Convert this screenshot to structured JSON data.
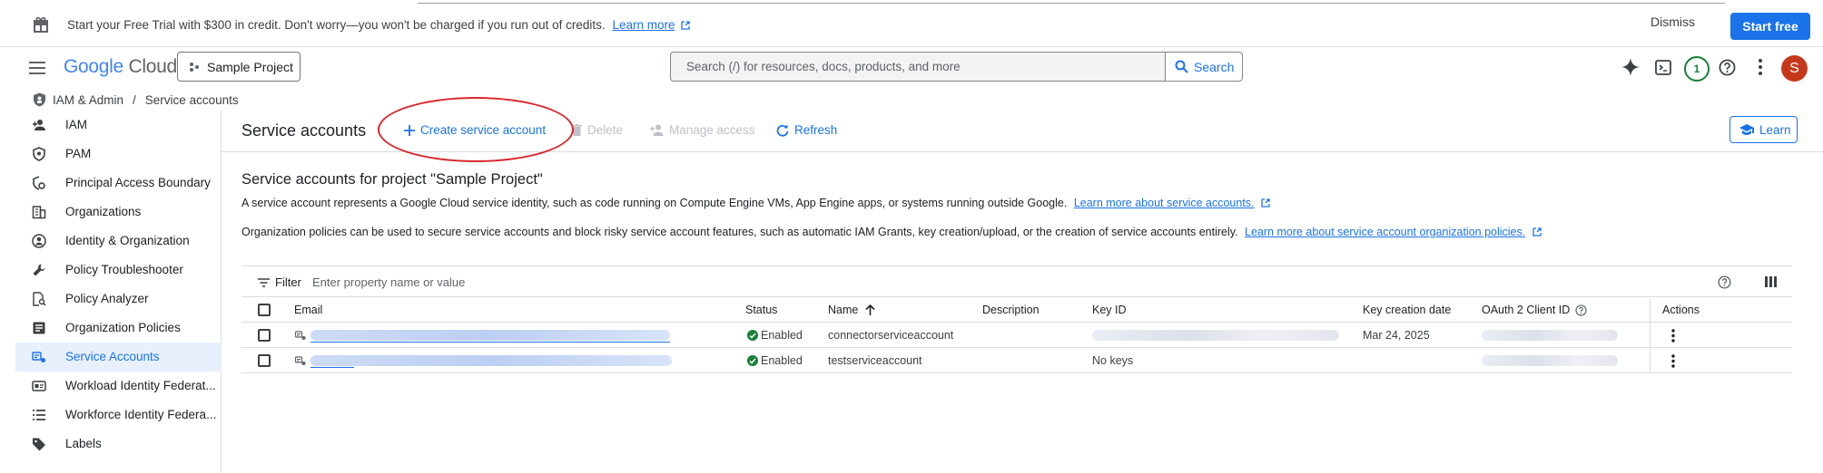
{
  "banner": {
    "text": "Start your Free Trial with $300 in credit. Don't worry—you won't be charged if you run out of credits.",
    "learn_more": "Learn more",
    "dismiss": "Dismiss",
    "start_free": "Start free"
  },
  "header": {
    "logo_google": "Google",
    "logo_cloud": "Cloud",
    "project": "Sample Project",
    "search_placeholder": "Search (/) for resources, docs, products, and more",
    "search_button": "Search",
    "notification_count": "1",
    "avatar_initial": "S"
  },
  "breadcrumb": {
    "section": "IAM & Admin",
    "separator": "/",
    "page": "Service accounts"
  },
  "sidebar": {
    "items": [
      {
        "label": "IAM",
        "icon": "person-add-icon"
      },
      {
        "label": "PAM",
        "icon": "shield-icon"
      },
      {
        "label": "Principal Access Boundary",
        "icon": "boundary-icon"
      },
      {
        "label": "Organizations",
        "icon": "building-icon"
      },
      {
        "label": "Identity & Organization",
        "icon": "account-circle-icon"
      },
      {
        "label": "Policy Troubleshooter",
        "icon": "wrench-icon"
      },
      {
        "label": "Policy Analyzer",
        "icon": "document-search-icon"
      },
      {
        "label": "Organization Policies",
        "icon": "list-box-icon"
      },
      {
        "label": "Service Accounts",
        "icon": "service-account-icon",
        "active": true
      },
      {
        "label": "Workload Identity Federat...",
        "icon": "id-card-icon"
      },
      {
        "label": "Workforce Identity Federa...",
        "icon": "list-icon"
      },
      {
        "label": "Labels",
        "icon": "tag-icon"
      }
    ]
  },
  "toolbar": {
    "title": "Service accounts",
    "create": "Create service account",
    "delete": "Delete",
    "manage_access": "Manage access",
    "refresh": "Refresh",
    "learn": "Learn"
  },
  "content": {
    "section_title": "Service accounts for project \"Sample Project\"",
    "para1": "A service account represents a Google Cloud service identity, such as code running on Compute Engine VMs, App Engine apps, or systems running outside Google.",
    "para1_link": "Learn more about service accounts.",
    "para2": "Organization policies can be used to secure service accounts and block risky service account features, such as automatic IAM Grants, key creation/upload, or the creation of service accounts entirely.",
    "para2_link": "Learn more about service account organization policies."
  },
  "table": {
    "filter_label": "Filter",
    "filter_placeholder": "Enter property name or value",
    "columns": {
      "email": "Email",
      "status": "Status",
      "name": "Name",
      "description": "Description",
      "key_id": "Key ID",
      "key_creation_date": "Key creation date",
      "oauth_client_id": "OAuth 2 Client ID",
      "actions": "Actions"
    },
    "rows": [
      {
        "status": "Enabled",
        "name": "connectorserviceaccount",
        "description": "",
        "key_id": "",
        "key_creation_date": "Mar 24, 2025"
      },
      {
        "status": "Enabled",
        "name": "testserviceaccount",
        "description": "",
        "key_id": "No keys",
        "key_creation_date": ""
      }
    ]
  },
  "colors": {
    "accent": "#1a73e8",
    "status_green": "#188038",
    "highlight_ellipse": "#d9262b",
    "avatar": "#c5391a"
  }
}
